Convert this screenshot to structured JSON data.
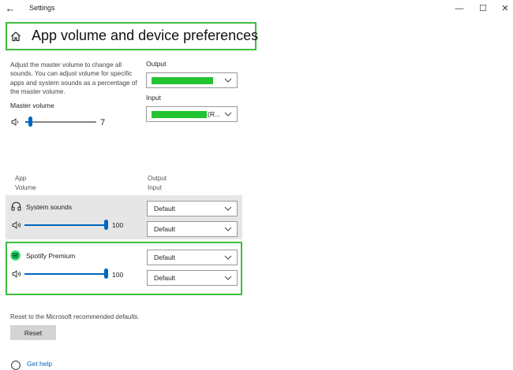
{
  "window": {
    "title": "Settings",
    "controls": [
      "—",
      "☐",
      "✕"
    ]
  },
  "header": {
    "title": "App volume and device preferences"
  },
  "master": {
    "description": "Adjust the master volume to change all sounds. You can adjust volume for specific apps and system sounds as a percentage of the master volume.",
    "label": "Master volume",
    "value": "7",
    "level": 0.07
  },
  "output": {
    "label": "Output",
    "value": ""
  },
  "input": {
    "label": "Input",
    "value": "(R..."
  },
  "columns": {
    "app": "App",
    "volume": "Volume",
    "output": "Output",
    "input": "Input"
  },
  "apps": [
    {
      "name": "System sounds",
      "volume": "100",
      "level": 1.0,
      "output": "Default",
      "input": "Default",
      "icon": "headphones-icon"
    },
    {
      "name": "Spotify Premium",
      "volume": "100",
      "level": 1.0,
      "output": "Default",
      "input": "Default",
      "icon": "spotify-icon"
    }
  ],
  "reset": {
    "text": "Reset to the Microsoft recommended defaults.",
    "button": "Reset"
  },
  "help": {
    "link": "Get help"
  },
  "colors": {
    "accent": "#0067c0",
    "highlight": "#3dbd3d",
    "redaction": "#22c432"
  }
}
